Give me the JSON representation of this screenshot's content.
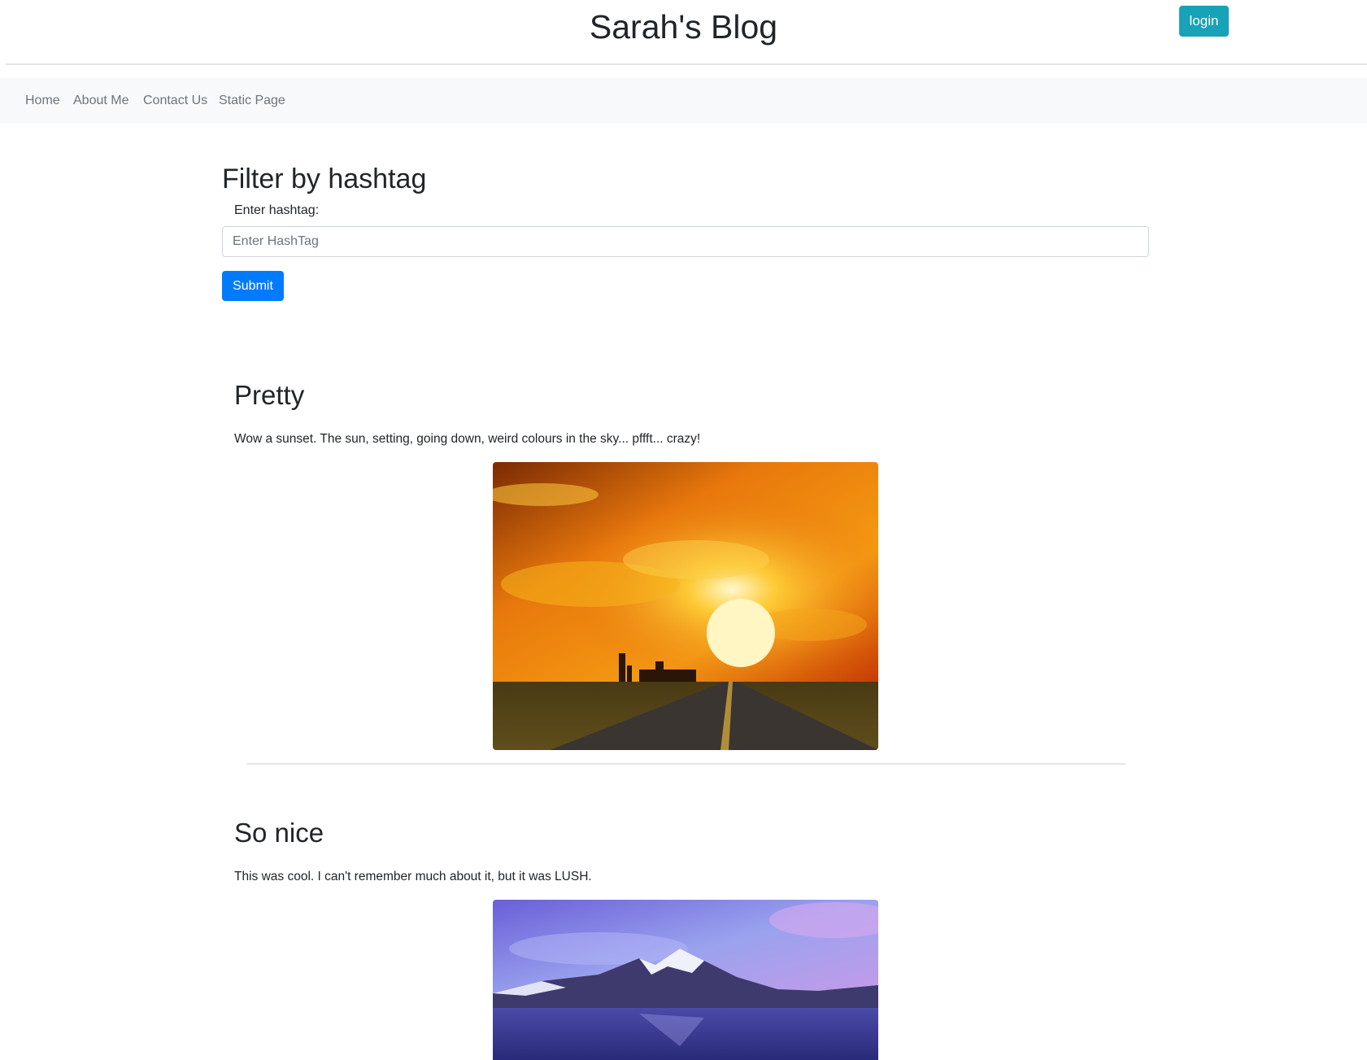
{
  "header": {
    "title": "Sarah's Blog",
    "login_label": "login"
  },
  "nav": {
    "items": [
      {
        "label": "Home"
      },
      {
        "label": "About Me"
      },
      {
        "label": "Contact Us"
      },
      {
        "label": "Static Page"
      }
    ]
  },
  "filter": {
    "heading": "Filter by hashtag",
    "label": "Enter hashtag:",
    "input_value": "",
    "input_placeholder": "Enter HashTag",
    "submit_label": "Submit"
  },
  "posts": [
    {
      "title": "Pretty",
      "body": "Wow a sunset. The sun, setting, going down, weird colours in the sky... pffft... crazy!"
    },
    {
      "title": "So nice",
      "body": "This was cool. I can't remember much about it, but it was LUSH."
    }
  ],
  "colors": {
    "login_button": "#17a2b8",
    "submit_button": "#007bff",
    "navbar_bg": "#f8f9fa",
    "nav_link": "#6c757d"
  }
}
